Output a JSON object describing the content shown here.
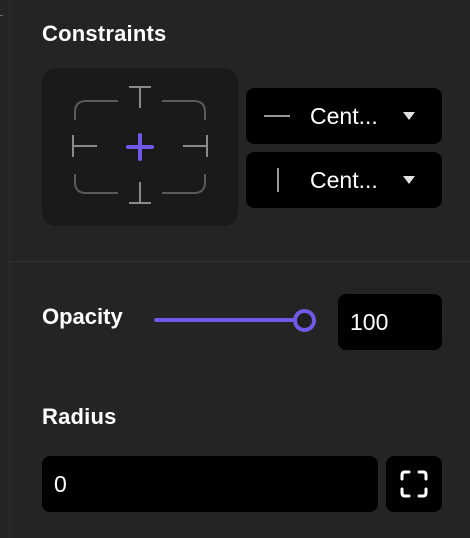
{
  "constraints": {
    "title": "Constraints",
    "horizontal": {
      "value": "Cent...",
      "icon": "horizontal-line-icon"
    },
    "vertical": {
      "value": "Cent...",
      "icon": "vertical-line-icon"
    }
  },
  "opacity": {
    "label": "Opacity",
    "value": "100",
    "slider_percent": 100
  },
  "radius": {
    "title": "Radius",
    "value": "0",
    "independent_corners_icon": "corners-icon"
  },
  "colors": {
    "accent": "#7059e6",
    "panel": "#242424",
    "field": "#000000",
    "widget": "#1a1a1a"
  }
}
